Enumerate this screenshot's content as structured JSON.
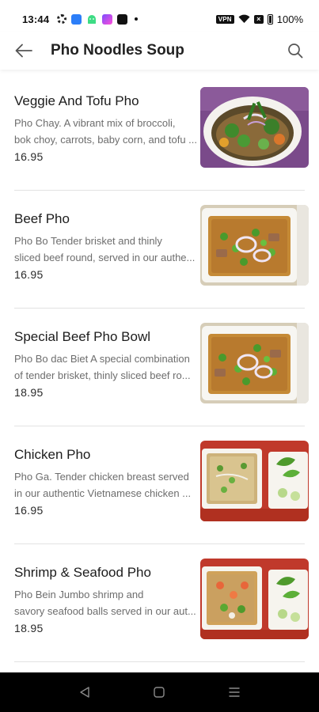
{
  "status_bar": {
    "time": "13:44",
    "vpn": "VPN",
    "battery": "100%"
  },
  "header": {
    "title": "Pho Noodles Soup"
  },
  "items": [
    {
      "name": "Veggie And Tofu Pho",
      "desc_line1": "Pho Chay. A vibrant mix of broccoli,",
      "desc_line2": "bok choy, carrots, baby corn, and tofu ...",
      "price": "16.95"
    },
    {
      "name": "Beef Pho",
      "desc_line1": "Pho Bo Tender brisket and thinly",
      "desc_line2": "sliced beef round, served in our authe...",
      "price": "16.95"
    },
    {
      "name": "Special Beef Pho Bowl",
      "desc_line1": "Pho Bo dac Biet A special combination",
      "desc_line2": "of tender brisket, thinly sliced beef ro...",
      "price": "18.95"
    },
    {
      "name": "Chicken Pho",
      "desc_line1": "Pho Ga.  Tender chicken breast served",
      "desc_line2": "in our authentic Vietnamese chicken ...",
      "price": "16.95"
    },
    {
      "name": "Shrimp & Seafood Pho",
      "desc_line1": "Pho Bein Jumbo shrimp and",
      "desc_line2": "savory seafood balls served in our aut...",
      "price": "18.95"
    }
  ],
  "colors": {
    "accent": "#222222",
    "divider": "#e2e2e2",
    "nav_bg": "#000000"
  },
  "icons": {
    "back": "arrow-left-icon",
    "search": "search-icon",
    "nav_back": "triangle-back-icon",
    "nav_home": "square-home-icon",
    "nav_menu": "three-lines-menu-icon"
  }
}
